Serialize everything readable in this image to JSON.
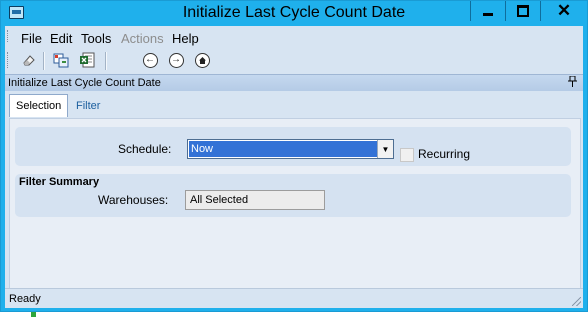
{
  "window": {
    "title": "Initialize Last Cycle Count Date"
  },
  "menu": {
    "file": "File",
    "edit": "Edit",
    "tools": "Tools",
    "actions": "Actions",
    "help": "Help"
  },
  "toolbar": {
    "icons": [
      "eraser-icon",
      "grid-icon",
      "excel-icon",
      "back-icon",
      "forward-icon",
      "home-icon"
    ]
  },
  "panel": {
    "title": "Initialize Last Cycle Count Date",
    "pin": "⚀"
  },
  "tabs": [
    {
      "label": "Selection",
      "active": true
    },
    {
      "label": "Filter",
      "active": false
    }
  ],
  "schedule": {
    "label": "Schedule:",
    "value": "Now",
    "recurring_label": "Recurring",
    "recurring_checked": false
  },
  "filter_summary": {
    "title": "Filter Summary",
    "warehouses_label": "Warehouses:",
    "warehouses_value": "All Selected"
  },
  "status": {
    "text": "Ready"
  },
  "colors": {
    "titlebar": "#1fb0ec",
    "client": "#d7e4f2",
    "selection": "#3372d6"
  }
}
